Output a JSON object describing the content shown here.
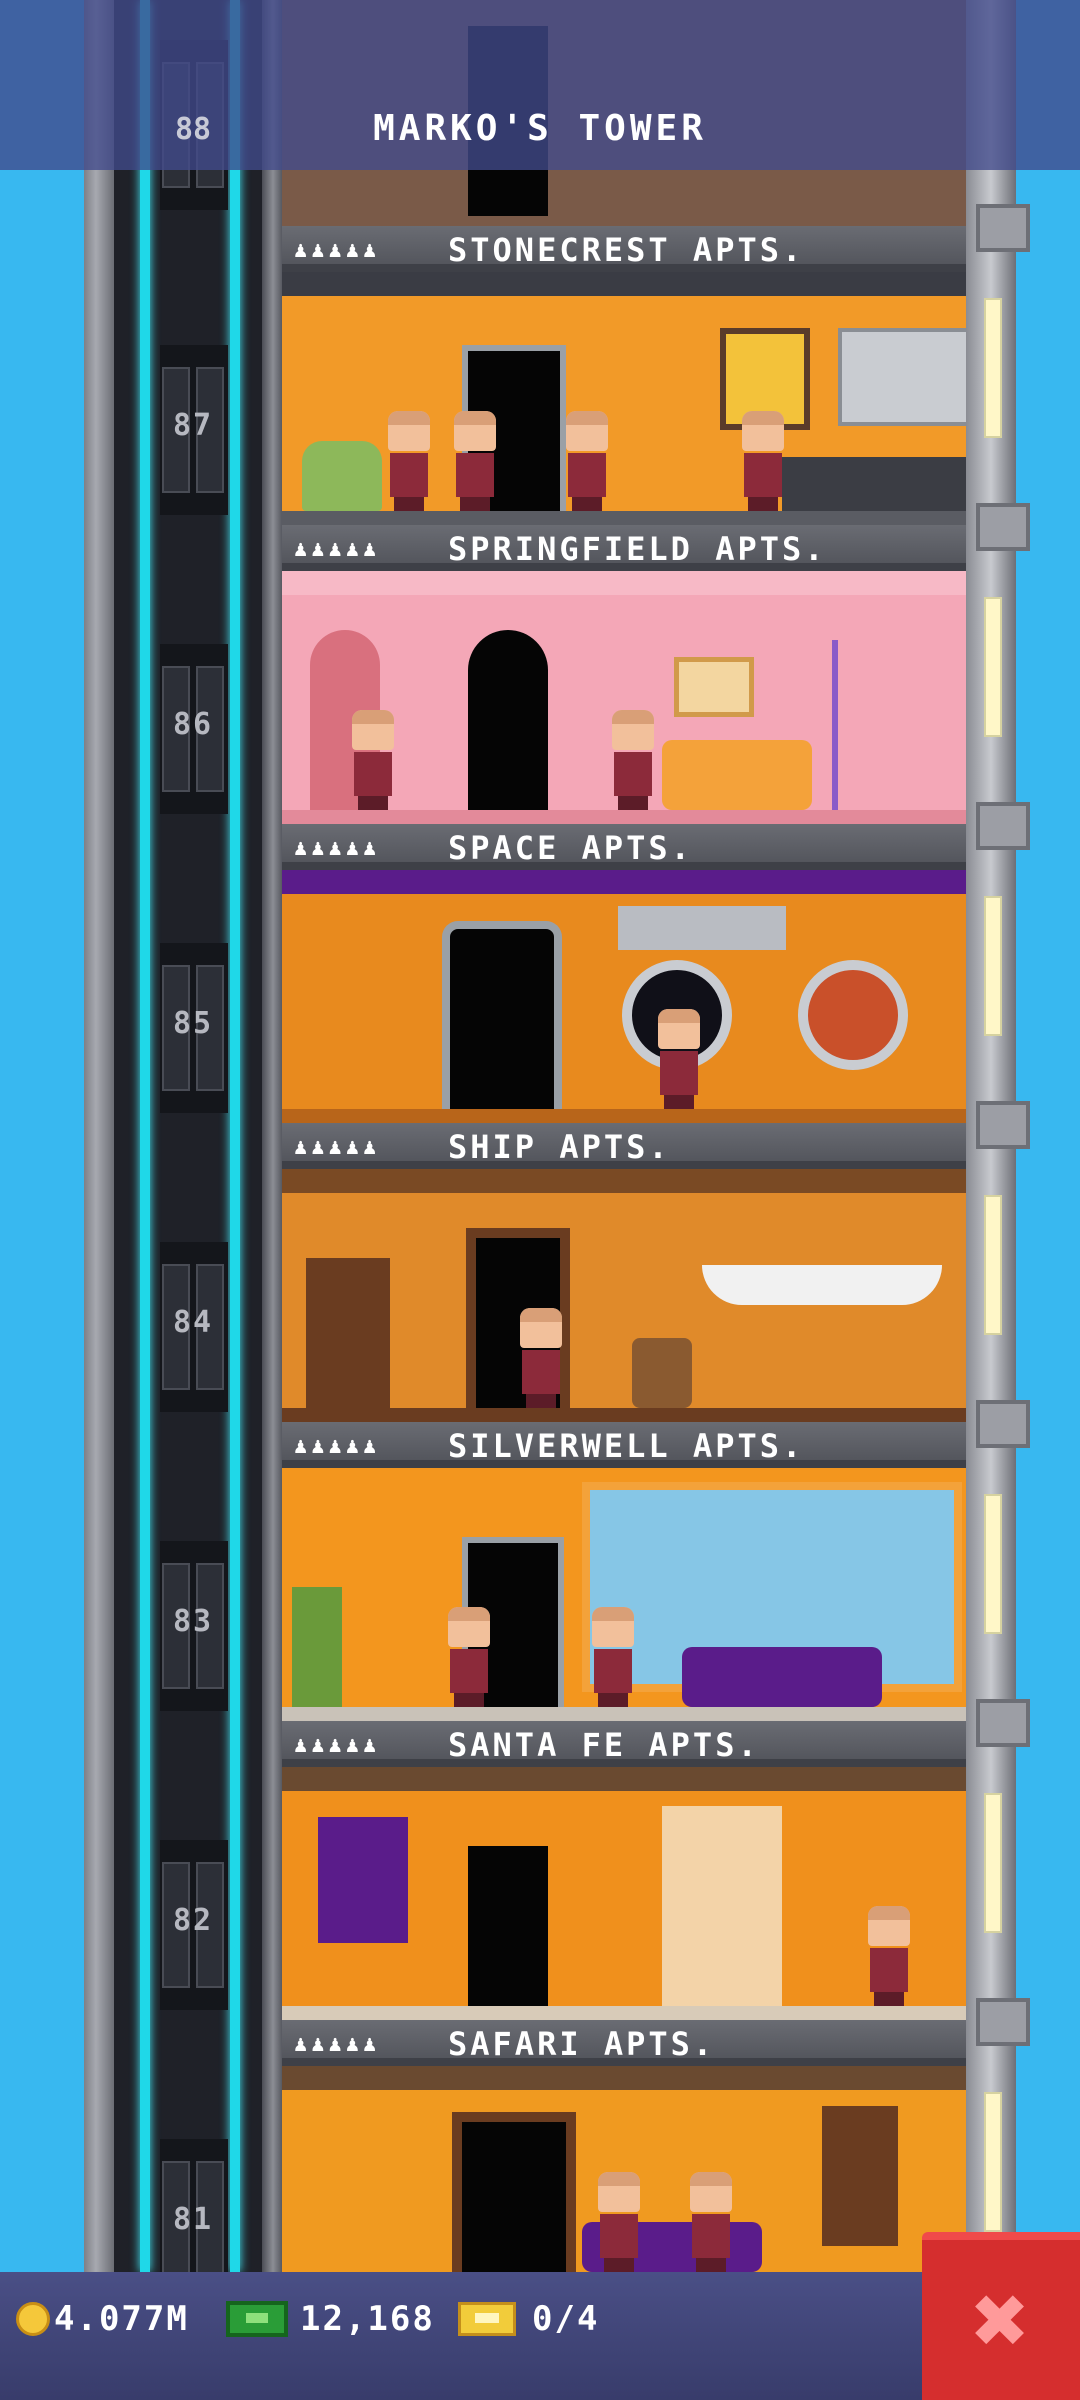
{
  "app": {
    "title": "MARKO'S TOWER"
  },
  "header": {
    "top_floor_number": "88"
  },
  "rating_stars": "♟♟♟♟♟",
  "floors": [
    {
      "number": "87",
      "name": "STONECREST APTS.",
      "theme_color": "#f29a28"
    },
    {
      "number": "86",
      "name": "SPRINGFIELD APTS.",
      "theme_color": "#f4a7b7"
    },
    {
      "number": "85",
      "name": "SPACE APTS.",
      "theme_color": "#e88a1e"
    },
    {
      "number": "84",
      "name": "SHIP APTS.",
      "theme_color": "#e08a2a"
    },
    {
      "number": "83",
      "name": "SILVERWELL APTS.",
      "theme_color": "#f3961e"
    },
    {
      "number": "82",
      "name": "SANTA FE APTS.",
      "theme_color": "#f0901c"
    },
    {
      "number": "81",
      "name": "SAFARI APTS.",
      "theme_color": "#f09a20"
    }
  ],
  "status_bar": {
    "coins": "4.077M",
    "bux": "12,168",
    "tickets": "0/4"
  },
  "icons": {
    "coin": "coin-icon",
    "bux": "bux-icon",
    "ticket": "ticket-icon",
    "close": "close-icon"
  },
  "colors": {
    "sky": "#38b8f0",
    "close_button": "#d52e2e",
    "cable": "#1fd8e8"
  }
}
